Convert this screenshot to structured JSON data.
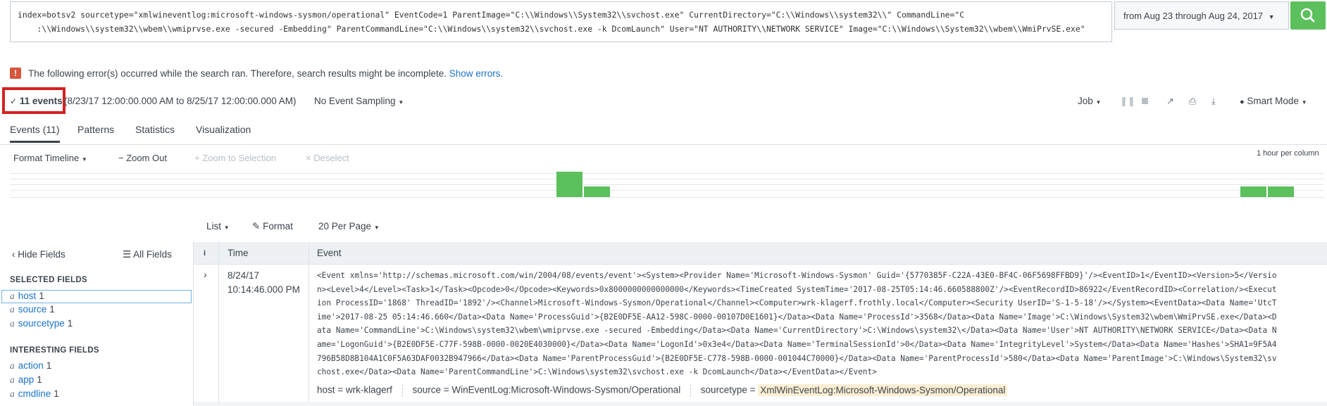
{
  "search": {
    "query": "index=botsv2 sourcetype=\"xmlwineventlog:microsoft-windows-sysmon/operational\" EventCode=1 ParentImage=\"C:\\\\Windows\\\\System32\\\\svchost.exe\" CurrentDirectory=\"C:\\\\Windows\\\\system32\\\\\" CommandLine=\"C\n    :\\\\Windows\\\\system32\\\\wbem\\\\wmiprvse.exe -secured -Embedding\" ParentCommandLine=\"C:\\\\Windows\\\\system32\\\\svchost.exe -k DcomLaunch\" User=\"NT AUTHORITY\\\\NETWORK SERVICE\" Image=\"C:\\\\Windows\\\\System32\\\\wbem\\\\WmiPrvSE.exe\"",
    "time_range": "from Aug 23 through Aug 24, 2017",
    "search_icon": "search-icon"
  },
  "error": {
    "icon": "!",
    "message": "The following error(s) occurred while the search ran. Therefore, search results might be incomplete.",
    "link": "Show errors."
  },
  "status": {
    "check": "✓",
    "event_count": "11 events",
    "date_range": "(8/23/17 12:00:00.000 AM to 8/25/17 12:00:00.000 AM)",
    "sampling": "No Event Sampling",
    "job": "Job",
    "mode": "Smart Mode"
  },
  "tabs": [
    "Events (11)",
    "Patterns",
    "Statistics",
    "Visualization"
  ],
  "timeline": {
    "format": "Format Timeline",
    "zoom_out": "Zoom Out",
    "zoom_selection": "Zoom to Selection",
    "deselect": "Deselect",
    "scale": "1 hour per column",
    "bars": [
      {
        "slot": 0,
        "level": 1.0
      },
      {
        "slot": 1,
        "level": 0.42
      },
      {
        "slot": 2,
        "level": 0.42
      },
      {
        "slot": 3,
        "level": 0.42
      }
    ]
  },
  "results": {
    "list": "List",
    "format": "Format",
    "per_page": "20 Per Page"
  },
  "sidebar": {
    "hide_fields": "Hide Fields",
    "all_fields": "All Fields",
    "selected_title": "SELECTED FIELDS",
    "interesting_title": "INTERESTING FIELDS",
    "selected": [
      {
        "type": "a",
        "name": "host",
        "count": "1"
      },
      {
        "type": "a",
        "name": "source",
        "count": "1"
      },
      {
        "type": "a",
        "name": "sourcetype",
        "count": "1"
      }
    ],
    "interesting": [
      {
        "type": "a",
        "name": "action",
        "count": "1"
      },
      {
        "type": "a",
        "name": "app",
        "count": "1"
      },
      {
        "type": "a",
        "name": "cmdline",
        "count": "1"
      }
    ]
  },
  "table": {
    "col_info": "i",
    "col_time": "Time",
    "col_event": "Event",
    "row": {
      "date": "8/24/17",
      "time": "10:14:46.000 PM",
      "event": "<Event xmlns='http://schemas.microsoft.com/win/2004/08/events/event'><System><Provider Name='Microsoft-Windows-Sysmon' Guid='{5770385F-C22A-43E0-BF4C-06F5698FFBD9}'/><EventID>1</EventID><Version>5</Versio\nn><Level>4</Level><Task>1</Task><Opcode>0</Opcode><Keywords>0x8000000000000000</Keywords><TimeCreated SystemTime='2017-08-25T05:14:46.660588800Z'/><EventRecordID>86922</EventRecordID><Correlation/><Execut\nion ProcessID='1868' ThreadID='1892'/><Channel>Microsoft-Windows-Sysmon/Operational</Channel><Computer>wrk-klagerf.frothly.local</Computer><Security UserID='S-1-5-18'/></System><EventData><Data Name='UtcT\nime'>2017-08-25 05:14:46.660</Data><Data Name='ProcessGuid'>{B2E0DF5E-AA12-598C-0000-00107D0E1601}</Data><Data Name='ProcessId'>3568</Data><Data Name='Image'>C:\\Windows\\System32\\wbem\\WmiPrvSE.exe</Data><D\nata Name='CommandLine'>C:\\Windows\\system32\\wbem\\wmiprvse.exe -secured -Embedding</Data><Data Name='CurrentDirectory'>C:\\Windows\\system32\\</Data><Data Name='User'>NT AUTHORITY\\NETWORK SERVICE</Data><Data N\name='LogonGuid'>{B2E0DF5E-C77F-598B-0000-0020E4030000}</Data><Data Name='LogonId'>0x3e4</Data><Data Name='TerminalSessionId'>0</Data><Data Name='IntegrityLevel'>System</Data><Data Name='Hashes'>SHA1=9F5A4\n796B58D8B104A1C0F5A63DAF0032B947966</Data><Data Name='ParentProcessGuid'>{B2E0DF5E-C778-598B-0000-001044C70000}</Data><Data Name='ParentProcessId'>580</Data><Data Name='ParentImage'>C:\\Windows\\System32\\sv\nchost.exe</Data><Data Name='ParentCommandLine'>C:\\Windows\\system32\\svchost.exe -k DcomLaunch</Data></EventData></Event>",
      "host_key": "host =",
      "host_val": "wrk-klagerf",
      "source_key": "source =",
      "source_val": "WinEventLog:Microsoft-Windows-Sysmon/Operational",
      "sourcetype_key": "sourcetype =",
      "sourcetype_val": "XmlWinEventLog:Microsoft-Windows-Sysmon/Operational"
    }
  },
  "colors": {
    "accent_green": "#5cc05c",
    "error_red": "#d6563c",
    "highlight_red": "#d42222",
    "link_blue": "#1a73c8"
  }
}
